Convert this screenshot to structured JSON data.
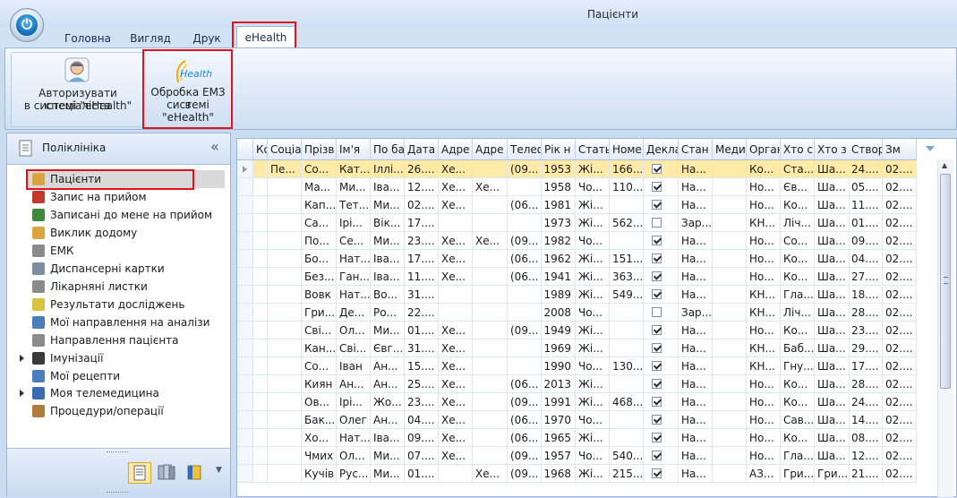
{
  "window": {
    "title": "Пацієнти"
  },
  "tabs": [
    {
      "label": "Головна"
    },
    {
      "label": "Вигляд"
    },
    {
      "label": "Друк"
    },
    {
      "label": "eHealth"
    }
  ],
  "ribbon": {
    "authorize_label_1": "Авторизувати спеціаліста",
    "authorize_label_2": "в системі \"eHealth\"",
    "emz_logo": "Health",
    "emz_label_1": "Обробка ЕМЗ в",
    "emz_label_2": "системі \"eHealth\""
  },
  "nav": {
    "title": "Поліклініка",
    "collapse_glyph": "«",
    "items": [
      {
        "label": "Пацієнти",
        "icon": "patients-icon",
        "color": "#d9a441"
      },
      {
        "label": "Запис на прийом",
        "icon": "appointment-icon",
        "color": "#c0392b"
      },
      {
        "label": "Записані до мене на прийом",
        "icon": "my-appointments-icon",
        "color": "#3c8a3c"
      },
      {
        "label": "Виклик додому",
        "icon": "home-visit-icon",
        "color": "#d9a441"
      },
      {
        "label": "ЕМК",
        "icon": "emk-icon",
        "color": "#8a8a8a"
      },
      {
        "label": "Диспансерні картки",
        "icon": "dispensary-cards-icon",
        "color": "#7d8da3"
      },
      {
        "label": "Лікарняні листки",
        "icon": "sick-leave-icon",
        "color": "#8a8a8a"
      },
      {
        "label": "Результати досліджень",
        "icon": "research-results-icon",
        "color": "#d9c441"
      },
      {
        "label": "Мої направлення на аналізи",
        "icon": "lab-referrals-icon",
        "color": "#4a7dbd"
      },
      {
        "label": "Направлення пацієнта",
        "icon": "patient-referral-icon",
        "color": "#8a8a8a"
      },
      {
        "label": "Імунізації",
        "icon": "immunization-icon",
        "color": "#3a3a3a"
      },
      {
        "label": "Мої рецепти",
        "icon": "prescriptions-icon",
        "color": "#4a7dbd"
      },
      {
        "label": "Моя телемедицина",
        "icon": "telemedicine-icon",
        "color": "#3c6ab0"
      },
      {
        "label": "Процедури/операції",
        "icon": "procedures-icon",
        "color": "#b07a3c"
      }
    ]
  },
  "grid": {
    "columns": [
      "Конта",
      "Соціа",
      "Прізв",
      "Ім'я",
      "По ба",
      "Дата",
      "Адре",
      "Адре",
      "Телеф",
      "Рік н",
      "Стать",
      "Номе",
      "Декла",
      "Стан",
      "Меди",
      "Орган",
      "Хто с",
      "Хто з",
      "Створ",
      "Зм"
    ],
    "rows": [
      [
        "",
        "Пе...",
        "Со...",
        "Кат...",
        "Іллі...",
        "26....",
        "Хе...",
        "",
        "(09...",
        "1953",
        "Жі...",
        "166...",
        true,
        "На...",
        "",
        "Ко...",
        "Ста...",
        "Ша...",
        "24....",
        "02...."
      ],
      [
        "",
        "",
        "Ма...",
        "Ми...",
        "Іва...",
        "12....",
        "Хе...",
        "Хе...",
        "",
        "1958",
        "Чо...",
        "110...",
        true,
        "На...",
        "",
        "Но...",
        "Єв...",
        "Ша...",
        "05....",
        "02...."
      ],
      [
        "",
        "",
        "Кап...",
        "Тет...",
        "Ми...",
        "02....",
        "Хе...",
        "",
        "(06...",
        "1981",
        "Жі...",
        "",
        true,
        "На...",
        "",
        "Но...",
        "Ко...",
        "Ша...",
        "11....",
        "02...."
      ],
      [
        "",
        "",
        "Са...",
        "Ірі...",
        "Вік...",
        "17....",
        "",
        "",
        "",
        "1973",
        "Жі...",
        "562...",
        false,
        "Зар...",
        "",
        "КН...",
        "Ліч...",
        "Ша...",
        "01....",
        "02...."
      ],
      [
        "",
        "",
        "По...",
        "Се...",
        "Ми...",
        "23....",
        "Хе...",
        "Хе...",
        "(09...",
        "1982",
        "Чо...",
        "",
        true,
        "На...",
        "",
        "Но...",
        "Со...",
        "Ша...",
        "09....",
        "02...."
      ],
      [
        "",
        "",
        "Бо...",
        "Нат...",
        "Іва...",
        "17....",
        "Хе...",
        "",
        "(06...",
        "1962",
        "Жі...",
        "151...",
        true,
        "На...",
        "",
        "Но...",
        "Ко...",
        "Ша...",
        "04....",
        "02...."
      ],
      [
        "",
        "",
        "Без...",
        "Ган...",
        "Іва...",
        "11....",
        "Хе...",
        "",
        "(06...",
        "1941",
        "Жі...",
        "363...",
        true,
        "На...",
        "",
        "Но...",
        "Ко...",
        "Ша...",
        "27....",
        "02...."
      ],
      [
        "",
        "",
        "Вовк",
        "Нат...",
        "Во...",
        "31....",
        "",
        "",
        "",
        "1989",
        "Жі...",
        "549...",
        true,
        "На...",
        "",
        "КН...",
        "Гла...",
        "Ша...",
        "18....",
        "02...."
      ],
      [
        "",
        "",
        "Гри...",
        "Де...",
        "Ро...",
        "22....",
        "",
        "",
        "",
        "2008",
        "Чо...",
        "",
        false,
        "Зар...",
        "",
        "КН...",
        "Ліч...",
        "Ша...",
        "28....",
        "02...."
      ],
      [
        "",
        "",
        "Сві...",
        "Ол...",
        "Ми...",
        "01....",
        "Хе...",
        "",
        "(09...",
        "1949",
        "Жі...",
        "",
        true,
        "На...",
        "",
        "Но...",
        "Ко...",
        "Ша...",
        "23....",
        "02...."
      ],
      [
        "",
        "",
        "Кан...",
        "Сві...",
        "Євг...",
        "31....",
        "Хе...",
        "",
        "",
        "1969",
        "Жі...",
        "",
        true,
        "На...",
        "",
        "КН...",
        "Баб...",
        "Ша...",
        "29....",
        "02...."
      ],
      [
        "",
        "",
        "Со...",
        "Іван",
        "Ан...",
        "15....",
        "Хе...",
        "",
        "",
        "1990",
        "Чо...",
        "130...",
        true,
        "На...",
        "",
        "КН...",
        "Гну...",
        "Ша...",
        "17....",
        "02...."
      ],
      [
        "",
        "",
        "Киян",
        "Ан...",
        "Ан...",
        "25....",
        "Хе...",
        "",
        "(06...",
        "2013",
        "Жі...",
        "",
        true,
        "На...",
        "",
        "Но...",
        "Ко...",
        "Ша...",
        "28....",
        "02...."
      ],
      [
        "",
        "",
        "Ов...",
        "Ірі...",
        "Жо...",
        "23....",
        "Хе...",
        "",
        "(09...",
        "1991",
        "Жі...",
        "468...",
        true,
        "На...",
        "",
        "Но...",
        "Ко...",
        "Ша...",
        "24....",
        "02...."
      ],
      [
        "",
        "",
        "Бак...",
        "Олег",
        "Ан...",
        "04....",
        "Хе...",
        "",
        "(06...",
        "1970",
        "Чо...",
        "",
        true,
        "На...",
        "",
        "Но...",
        "Сав...",
        "Ша...",
        "14....",
        "02...."
      ],
      [
        "",
        "",
        "Хо...",
        "Нат...",
        "Іва...",
        "09....",
        "Хе...",
        "",
        "(06...",
        "1965",
        "Жі...",
        "",
        true,
        "На...",
        "",
        "Но...",
        "Ко...",
        "Ша...",
        "08....",
        "02...."
      ],
      [
        "",
        "",
        "Чмих",
        "Ол...",
        "Ми...",
        "07....",
        "Хе...",
        "",
        "(09...",
        "1957",
        "Чо...",
        "540...",
        true,
        "На...",
        "",
        "Но...",
        "Гла...",
        "Ша...",
        "12....",
        "02...."
      ],
      [
        "",
        "",
        "Кучів",
        "Рус...",
        "Ми...",
        "01....",
        "",
        "Хе...",
        "(09...",
        "1968",
        "Жі...",
        "215...",
        true,
        "На...",
        "",
        "АЗ...",
        "Гри...",
        "Гри...",
        "21....",
        "02...."
      ]
    ]
  }
}
